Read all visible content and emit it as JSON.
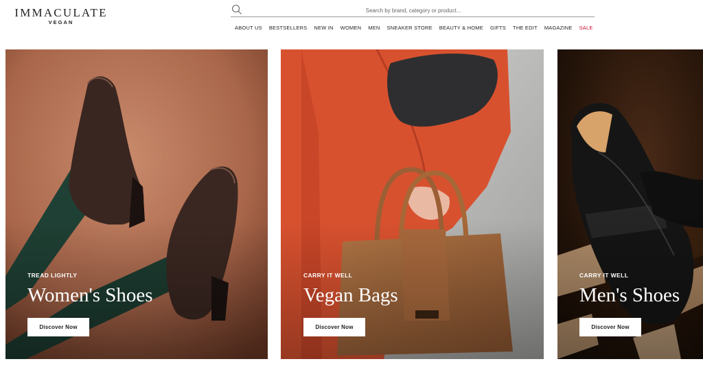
{
  "brand": {
    "name": "IMMACULATE",
    "tagline": "VEGAN"
  },
  "search": {
    "placeholder": "Search by brand, category or product..."
  },
  "nav": [
    {
      "label": "ABOUT US"
    },
    {
      "label": "BESTSELLERS"
    },
    {
      "label": "NEW IN"
    },
    {
      "label": "WOMEN"
    },
    {
      "label": "MEN"
    },
    {
      "label": "SNEAKER STORE"
    },
    {
      "label": "BEAUTY & HOME"
    },
    {
      "label": "GIFTS"
    },
    {
      "label": "THE EDIT"
    },
    {
      "label": "MAGAZINE"
    },
    {
      "label": "SALE",
      "color": "#c8102e"
    }
  ],
  "cards": [
    {
      "eyebrow": "TREAD LIGHTLY",
      "title": "Women's Shoes",
      "cta": "Discover Now"
    },
    {
      "eyebrow": "CARRY IT WELL",
      "title": "Vegan Bags",
      "cta": "Discover Now"
    },
    {
      "eyebrow": "CARRY IT WELL",
      "title": "Men's Shoes",
      "cta": "Discover Now"
    }
  ],
  "colors": {
    "sale": "#c8102e",
    "text": "#222222"
  }
}
